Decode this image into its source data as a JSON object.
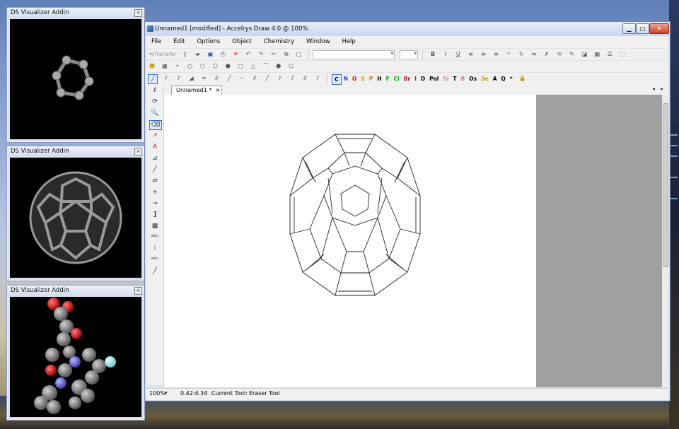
{
  "ds_windows": [
    {
      "title": "DS Visualizer Addin",
      "close": "×"
    },
    {
      "title": "DS Visualizer Addin",
      "close": "×"
    },
    {
      "title": "DS Visualizer Addin",
      "close": "×"
    }
  ],
  "main": {
    "title": "Unnamed1 [modified] - Accelrys Draw 4.0  @ 100%",
    "controls": {
      "minimize": "▁",
      "maximize": "□",
      "close": "✕"
    },
    "menu": [
      "File",
      "Edit",
      "Options",
      "Object",
      "Chemistry",
      "Window",
      "Help"
    ],
    "toolbar1": {
      "transfer_label": "Transfer"
    },
    "elements": [
      "C",
      "N",
      "O",
      "S",
      "P",
      "H",
      "F",
      "Cl",
      "Br",
      "I",
      "D",
      "Pol",
      "Si",
      "T",
      "B",
      "Os",
      "Se",
      "A",
      "Q",
      "*"
    ],
    "element_colors": {
      "C": "#000000",
      "N": "#1f3fd6",
      "O": "#e01010",
      "S": "#c8a000",
      "P": "#e07000",
      "H": "#000000",
      "F": "#18a018",
      "Cl": "#18a018",
      "Br": "#a02020",
      "I": "#7a20a0",
      "D": "#000000",
      "Pol": "#000000",
      "Si": "#c89090",
      "T": "#000000",
      "B": "#e07a9a",
      "Os": "#000000",
      "Se": "#c8a000",
      "A": "#000000",
      "Q": "#000000",
      "*": "#000000"
    },
    "tab": {
      "label": "Unnamed1 *",
      "close": "×",
      "nav_left": "◂",
      "nav_right": "▸"
    },
    "status": {
      "zoom": "100%",
      "coords": "0.42:4.34",
      "tool_label": "Current Tool:",
      "tool_value": "Eraser Tool"
    }
  }
}
